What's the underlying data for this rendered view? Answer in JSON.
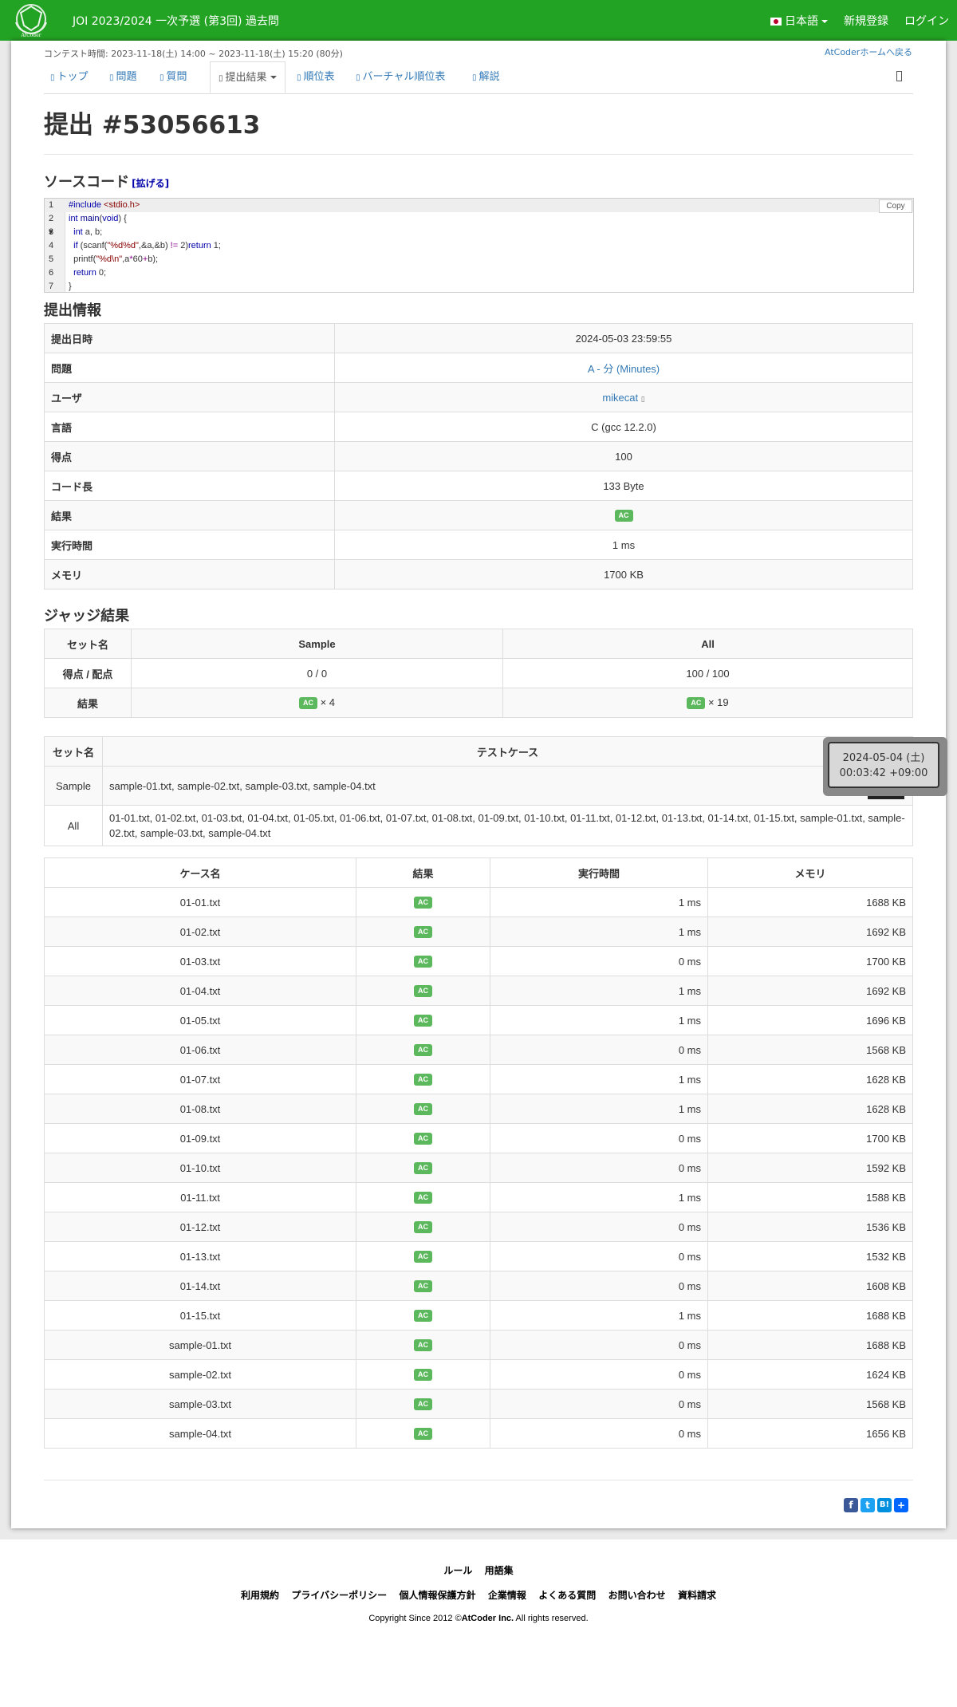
{
  "nav": {
    "logo_text": "AtCoder",
    "contest_title": "JOI 2023/2024 一次予選 (第3回) 過去問",
    "language": "日本語",
    "signup": "新規登録",
    "login": "ログイン"
  },
  "contest_time": "コンテスト時間: 2023-11-18(土) 14:00 ~ 2023-11-18(土) 15:20 (80分)",
  "back_link": "AtCoderホームへ戻る",
  "tabs": [
    {
      "label": "トップ"
    },
    {
      "label": "問題"
    },
    {
      "label": "質問"
    },
    {
      "label": "提出結果"
    },
    {
      "label": "順位表"
    },
    {
      "label": "バーチャル順位表"
    },
    {
      "label": "解説"
    }
  ],
  "page_title": "提出 #53056613",
  "source": {
    "heading": "ソースコード",
    "expand": "[拡げる]",
    "copy": "Copy",
    "line_numbers": [
      "1",
      "2",
      "3",
      "4",
      "5",
      "6",
      "7"
    ]
  },
  "info": {
    "heading": "提出情報",
    "rows": [
      {
        "label": "提出日時",
        "value": "2024-05-03 23:59:55"
      },
      {
        "label": "問題",
        "value": "A - 分 (Minutes)"
      },
      {
        "label": "ユーザ",
        "value": "mikecat"
      },
      {
        "label": "言語",
        "value": "C (gcc 12.2.0)"
      },
      {
        "label": "得点",
        "value": "100"
      },
      {
        "label": "コード長",
        "value": "133 Byte"
      },
      {
        "label": "結果",
        "value": "AC"
      },
      {
        "label": "実行時間",
        "value": "1 ms"
      },
      {
        "label": "メモリ",
        "value": "1700 KB"
      }
    ]
  },
  "judge": {
    "heading": "ジャッジ結果",
    "col_set": "セット名",
    "col_sample": "Sample",
    "col_all": "All",
    "row_score": "得点 / 配点",
    "sample_score": "0 / 0",
    "all_score": "100 / 100",
    "row_result": "結果",
    "sample_count": "× 4",
    "all_count": "× 19"
  },
  "testcases": {
    "col_set": "セット名",
    "col_cases": "テストケース",
    "rows": [
      {
        "set": "Sample",
        "cases": "sample-01.txt, sample-02.txt, sample-03.txt, sample-04.txt"
      },
      {
        "set": "All",
        "cases": "01-01.txt, 01-02.txt, 01-03.txt, 01-04.txt, 01-05.txt, 01-06.txt, 01-07.txt, 01-08.txt, 01-09.txt, 01-10.txt, 01-11.txt, 01-12.txt, 01-13.txt, 01-14.txt, 01-15.txt, sample-01.txt, sample-02.txt, sample-03.txt, sample-04.txt"
      }
    ]
  },
  "cases": {
    "headers": [
      "ケース名",
      "結果",
      "実行時間",
      "メモリ"
    ],
    "rows": [
      {
        "name": "01-01.txt",
        "status": "AC",
        "time": "1 ms",
        "memory": "1688 KB"
      },
      {
        "name": "01-02.txt",
        "status": "AC",
        "time": "1 ms",
        "memory": "1692 KB"
      },
      {
        "name": "01-03.txt",
        "status": "AC",
        "time": "0 ms",
        "memory": "1700 KB"
      },
      {
        "name": "01-04.txt",
        "status": "AC",
        "time": "1 ms",
        "memory": "1692 KB"
      },
      {
        "name": "01-05.txt",
        "status": "AC",
        "time": "1 ms",
        "memory": "1696 KB"
      },
      {
        "name": "01-06.txt",
        "status": "AC",
        "time": "0 ms",
        "memory": "1568 KB"
      },
      {
        "name": "01-07.txt",
        "status": "AC",
        "time": "1 ms",
        "memory": "1628 KB"
      },
      {
        "name": "01-08.txt",
        "status": "AC",
        "time": "1 ms",
        "memory": "1628 KB"
      },
      {
        "name": "01-09.txt",
        "status": "AC",
        "time": "0 ms",
        "memory": "1700 KB"
      },
      {
        "name": "01-10.txt",
        "status": "AC",
        "time": "0 ms",
        "memory": "1592 KB"
      },
      {
        "name": "01-11.txt",
        "status": "AC",
        "time": "1 ms",
        "memory": "1588 KB"
      },
      {
        "name": "01-12.txt",
        "status": "AC",
        "time": "0 ms",
        "memory": "1536 KB"
      },
      {
        "name": "01-13.txt",
        "status": "AC",
        "time": "0 ms",
        "memory": "1532 KB"
      },
      {
        "name": "01-14.txt",
        "status": "AC",
        "time": "0 ms",
        "memory": "1608 KB"
      },
      {
        "name": "01-15.txt",
        "status": "AC",
        "time": "1 ms",
        "memory": "1688 KB"
      },
      {
        "name": "sample-01.txt",
        "status": "AC",
        "time": "0 ms",
        "memory": "1688 KB"
      },
      {
        "name": "sample-02.txt",
        "status": "AC",
        "time": "0 ms",
        "memory": "1624 KB"
      },
      {
        "name": "sample-03.txt",
        "status": "AC",
        "time": "0 ms",
        "memory": "1568 KB"
      },
      {
        "name": "sample-04.txt",
        "status": "AC",
        "time": "0 ms",
        "memory": "1656 KB"
      }
    ]
  },
  "tooltip": {
    "line1": "2024-05-04 (土)",
    "line2": "00:03:42 +09:00"
  },
  "share": {
    "b_label": "B!"
  },
  "footer": {
    "row1": [
      "ルール",
      "用語集"
    ],
    "row2": [
      "利用規約",
      "プライバシーポリシー",
      "個人情報保護方針",
      "企業情報",
      "よくある質問",
      "お問い合わせ",
      "資料請求"
    ],
    "copyright_prefix": "Copyright Since 2012 ©",
    "copyright_company": "AtCoder Inc.",
    "copyright_suffix": " All rights reserved."
  },
  "colors": {
    "brand": "#23a323",
    "ac": "#5cb85c",
    "link": "#337ab7"
  }
}
